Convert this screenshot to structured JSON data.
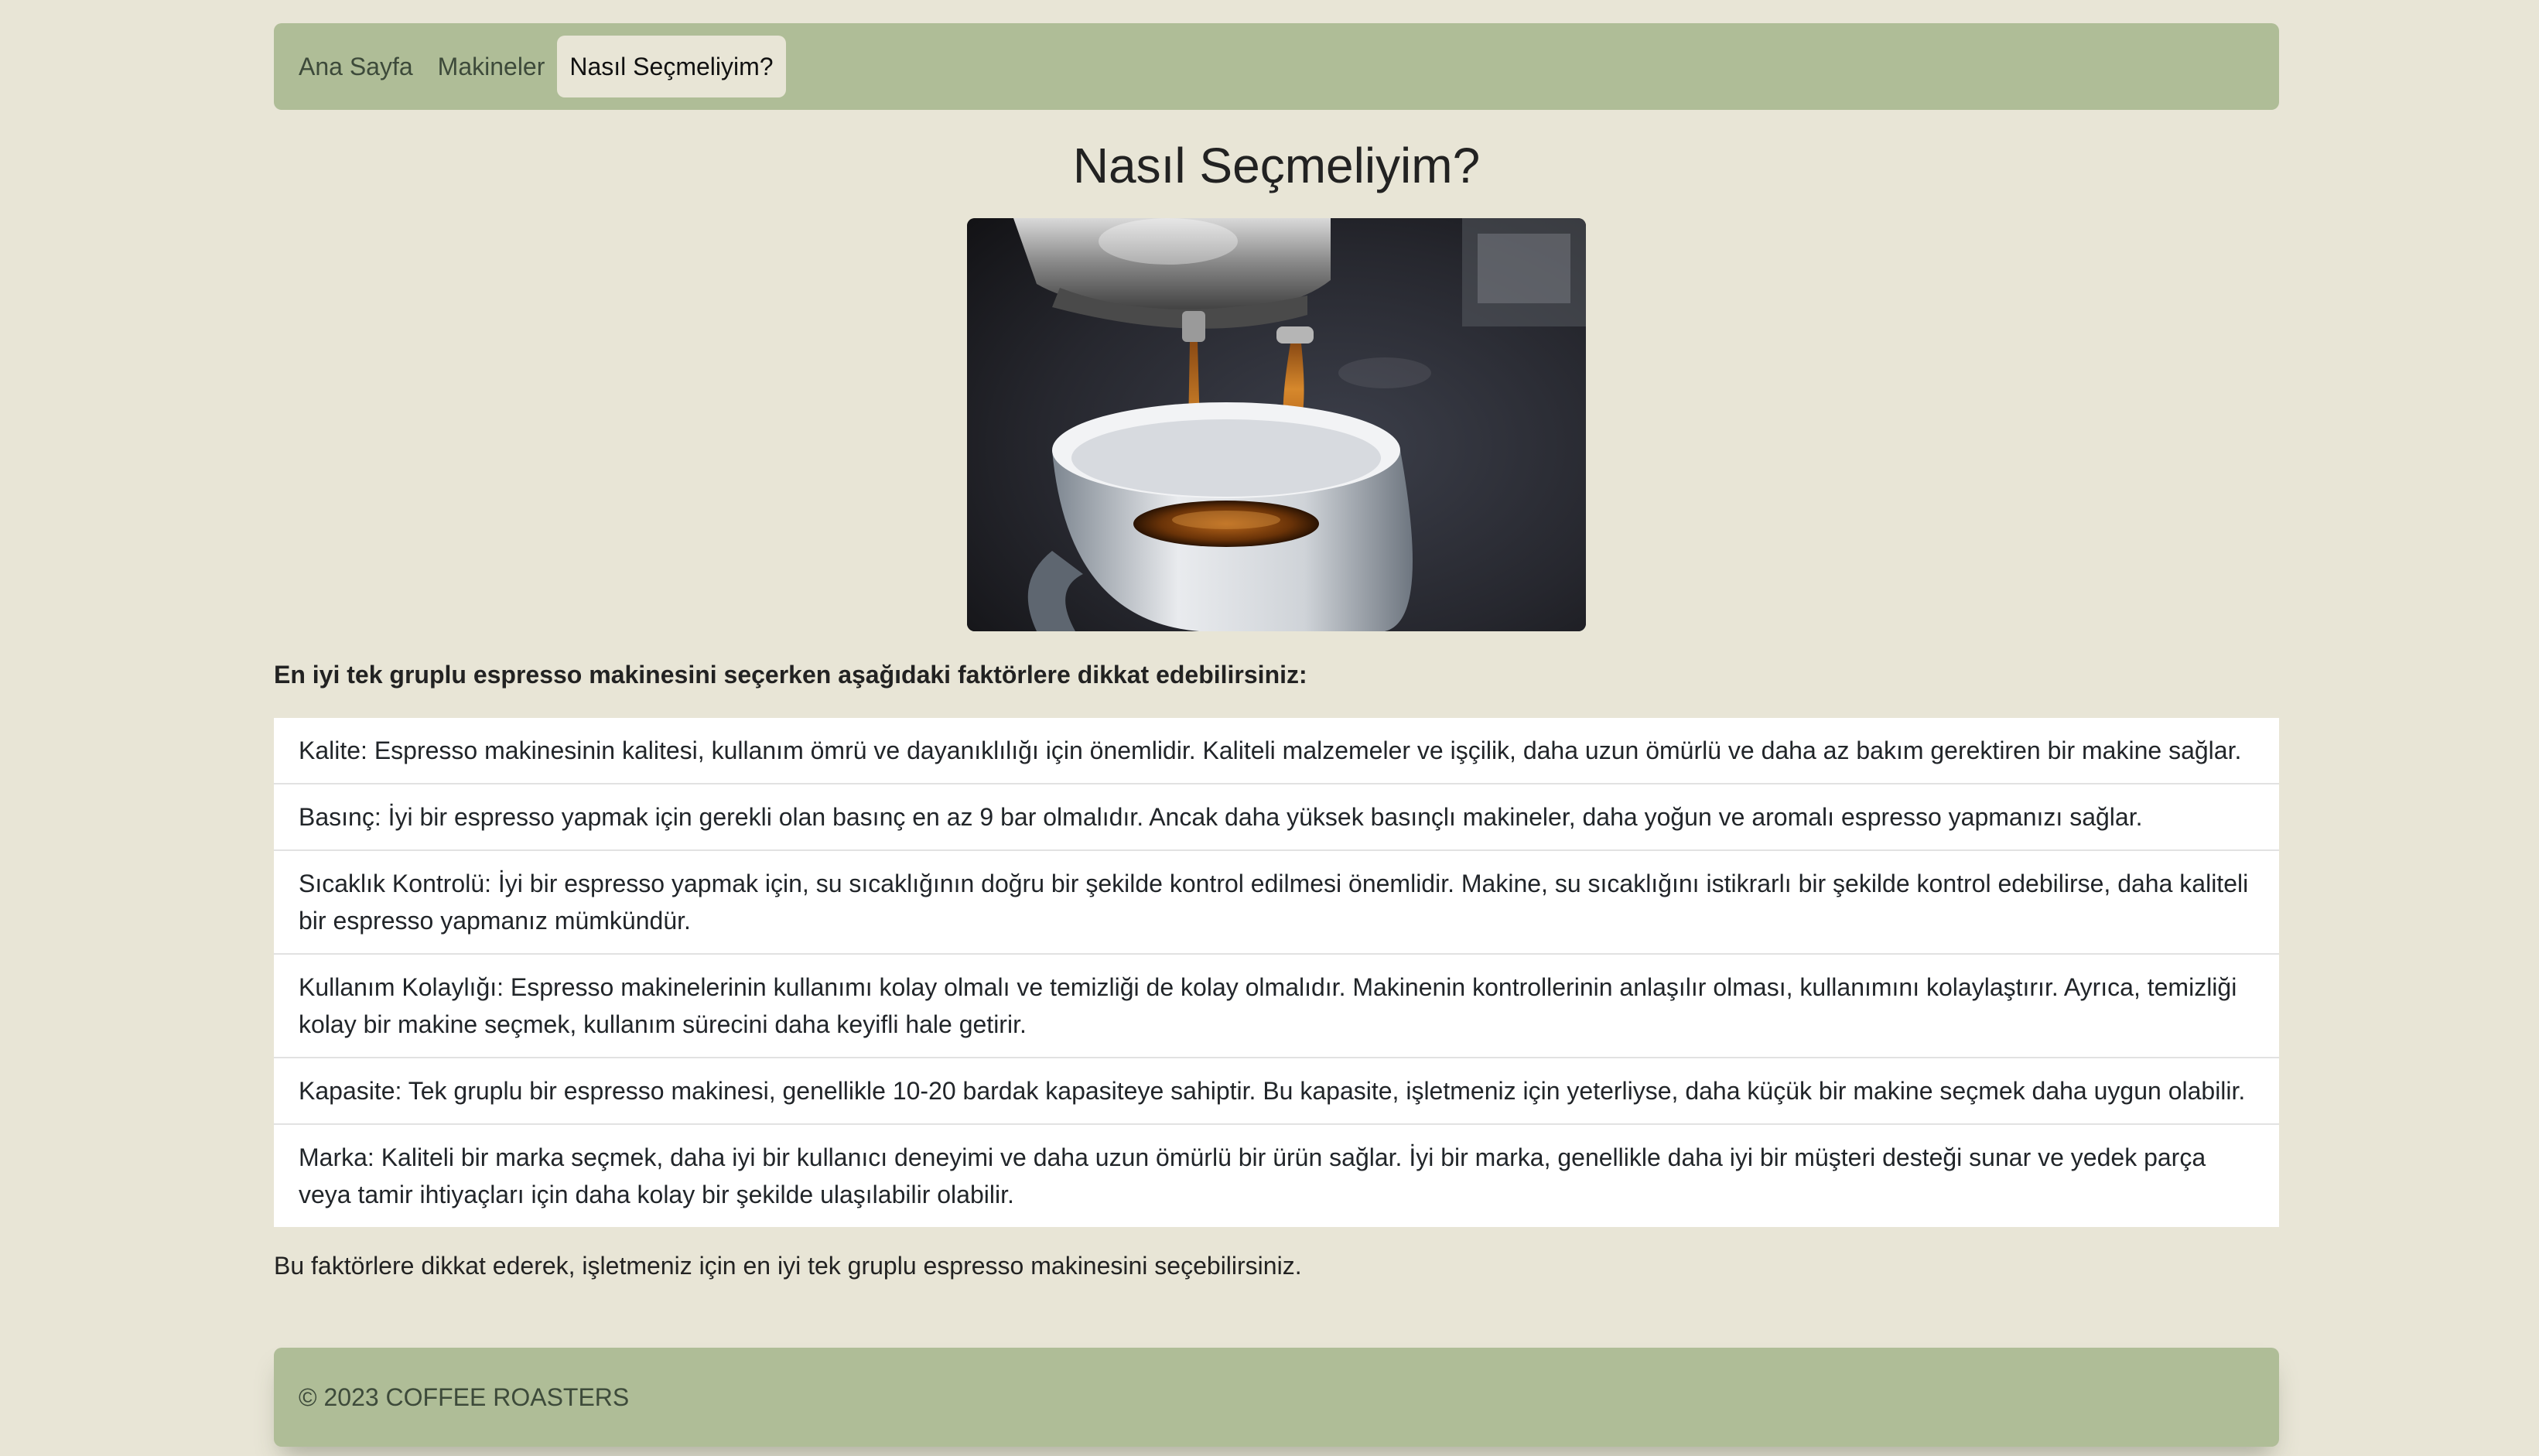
{
  "nav": {
    "items": [
      {
        "label": "Ana Sayfa",
        "active": false
      },
      {
        "label": "Makineler",
        "active": false
      },
      {
        "label": "Nasıl Seçmeliyim?",
        "active": true
      }
    ]
  },
  "page": {
    "title": "Nasıl Seçmeliyim?",
    "image_alt": "espresso-pouring-into-cup",
    "intro": "En iyi tek gruplu espresso makinesini seçerken aşağıdaki faktörlere dikkat edebilirsiniz:",
    "factors": [
      "Kalite: Espresso makinesinin kalitesi, kullanım ömrü ve dayanıklılığı için önemlidir. Kaliteli malzemeler ve işçilik, daha uzun ömürlü ve daha az bakım gerektiren bir makine sağlar.",
      "Basınç: İyi bir espresso yapmak için gerekli olan basınç en az 9 bar olmalıdır. Ancak daha yüksek basınçlı makineler, daha yoğun ve aromalı espresso yapmanızı sağlar.",
      "Sıcaklık Kontrolü: İyi bir espresso yapmak için, su sıcaklığının doğru bir şekilde kontrol edilmesi önemlidir. Makine, su sıcaklığını istikrarlı bir şekilde kontrol edebilirse, daha kaliteli bir espresso yapmanız mümkündür.",
      "Kullanım Kolaylığı: Espresso makinelerinin kullanımı kolay olmalı ve temizliği de kolay olmalıdır. Makinenin kontrollerinin anlaşılır olması, kullanımını kolaylaştırır. Ayrıca, temizliği kolay bir makine seçmek, kullanım sürecini daha keyifli hale getirir.",
      "Kapasite: Tek gruplu bir espresso makinesi, genellikle 10-20 bardak kapasiteye sahiptir. Bu kapasite, işletmeniz için yeterliyse, daha küçük bir makine seçmek daha uygun olabilir.",
      "Marka: Kaliteli bir marka seçmek, daha iyi bir kullanıcı deneyimi ve daha uzun ömürlü bir ürün sağlar. İyi bir marka, genellikle daha iyi bir müşteri desteği sunar ve yedek parça veya tamir ihtiyaçları için daha kolay bir şekilde ulaşılabilir olabilir."
    ],
    "outro": "Bu faktörlere dikkat ederek, işletmeniz için en iyi tek gruplu espresso makinesini seçebilirsiniz."
  },
  "footer": {
    "text": "© 2023 COFFEE ROASTERS"
  },
  "colors": {
    "background": "#e8e5d6",
    "navbar": "#afbd97",
    "list_background": "#ffffff"
  }
}
